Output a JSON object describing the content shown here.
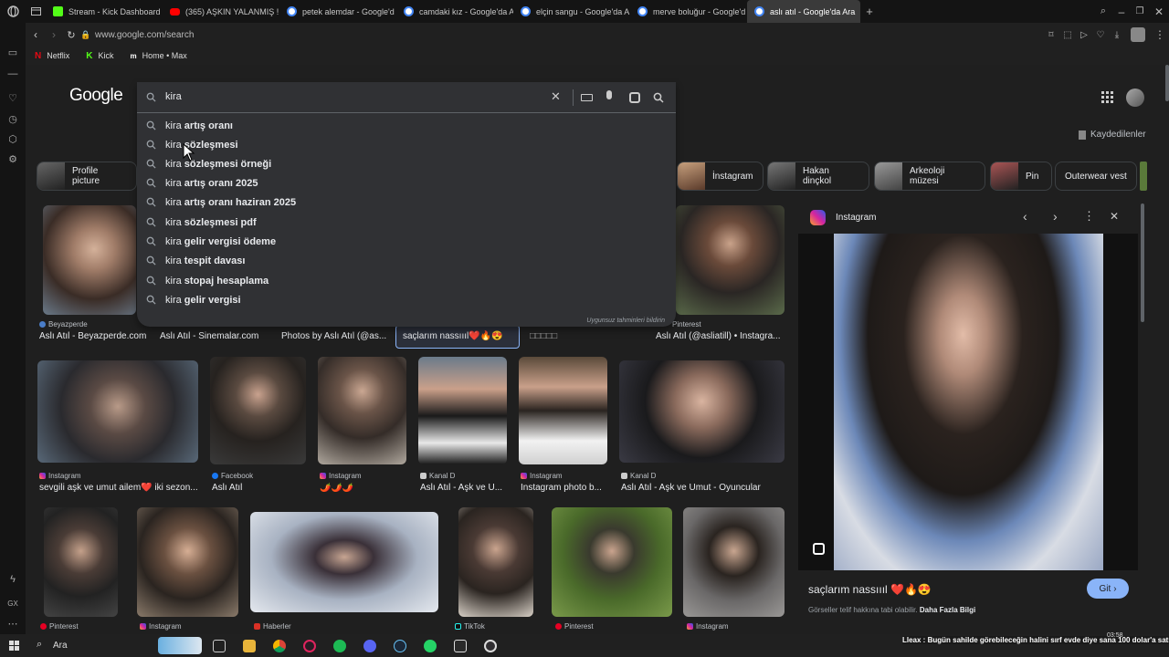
{
  "tabs": [
    {
      "label": "Stream - Kick Dashboard",
      "color": "#53fc18"
    },
    {
      "label": "(365) AŞKIN YALANMIŞ ! ",
      "color": "#ff0000"
    },
    {
      "label": "petek alemdar - Google'd",
      "color": "#ffffff"
    },
    {
      "label": "camdaki kız - Google'da A",
      "color": "#ffffff"
    },
    {
      "label": "elçin sangu - Google'da A",
      "color": "#ffffff"
    },
    {
      "label": "merve boluğur - Google'd",
      "color": "#ffffff"
    },
    {
      "label": "aslı atıl - Google'da Ara",
      "color": "#ffffff",
      "active": true
    }
  ],
  "address": {
    "url": "www.google.com/search"
  },
  "bookmarks": [
    "Netflix",
    "Kick",
    "Home • Max"
  ],
  "search": {
    "logo": "Google",
    "query": "kira",
    "saved_label": "Kaydedilenler"
  },
  "suggestions": [
    {
      "prefix": "kira",
      "rest": "artış oranı"
    },
    {
      "prefix": "kira",
      "rest": "sözleşmesi"
    },
    {
      "prefix": "kira",
      "rest": "sözleşmesi örneği"
    },
    {
      "prefix": "kira",
      "rest": "artış oranı 2025"
    },
    {
      "prefix": "kira",
      "rest": "artış oranı haziran 2025"
    },
    {
      "prefix": "kira",
      "rest": "sözleşmesi pdf"
    },
    {
      "prefix": "kira",
      "rest": "gelir vergisi ödeme"
    },
    {
      "prefix": "kira",
      "rest": "tespit davası"
    },
    {
      "prefix": "kira",
      "rest": "stopaj hesaplama"
    },
    {
      "prefix": "kira",
      "rest": "gelir vergisi"
    }
  ],
  "suggest_footer": "Uygunsuz tahminleri bildirin",
  "chips": [
    "Profile picture",
    "İnstagram",
    "Hakan dinçkol",
    "Arkeoloji müzesi",
    "Pin",
    "Outerwear vest"
  ],
  "row1": [
    {
      "source": "Beyazperde",
      "caption": "Aslı Atıl - Beyazperde.com"
    },
    {
      "source": "",
      "caption": "Aslı Atıl - Sinemalar.com"
    },
    {
      "source": "",
      "caption": "Photos by Aslı Atıl (@as..."
    },
    {
      "source": "",
      "caption": "saçlarım nassıııl❤️🔥😍"
    },
    {
      "source": "",
      "caption": "□□□□□"
    },
    {
      "source": "Pinterest",
      "caption": "Aslı Atıl (@asliatill) • Instagra..."
    }
  ],
  "row2": [
    {
      "source": "Instagram",
      "caption": "sevgili aşk ve umut ailem❤️ iki sezon..."
    },
    {
      "source": "Facebook",
      "caption": "Aslı Atıl"
    },
    {
      "source": "Instagram",
      "caption": "🌶️🌶️🌶️"
    },
    {
      "source": "Kanal D",
      "caption": "Aslı Atıl - Aşk ve U..."
    },
    {
      "source": "Instagram",
      "caption": "Instagram photo b..."
    },
    {
      "source": "Kanal D",
      "caption": "Aslı Atıl - Aşk ve Umut - Oyuncular"
    }
  ],
  "row3": [
    {
      "source": "Pinterest"
    },
    {
      "source": "Instagram"
    },
    {
      "source": "Haberler"
    },
    {
      "source": "TikTok"
    },
    {
      "source": "Pinterest"
    },
    {
      "source": "Instagram"
    }
  ],
  "preview": {
    "source": "Instagram",
    "caption": "saçlarım nassıııl ❤️🔥😍",
    "visit_label": "Git",
    "copyright": "Görseller telif hakkına tabi olabilir.",
    "more": "Daha Fazla Bilgi"
  },
  "taskbar": {
    "search": "Ara",
    "ticker": "Lleax : Bugün sahilde görebileceğin halini sırf evde diye sana 100 dolar'a satıyor",
    "time": "03:58"
  },
  "colors": {
    "accent": "#8ab4f8",
    "bg": "#1f1f1f",
    "panel": "#303134"
  }
}
